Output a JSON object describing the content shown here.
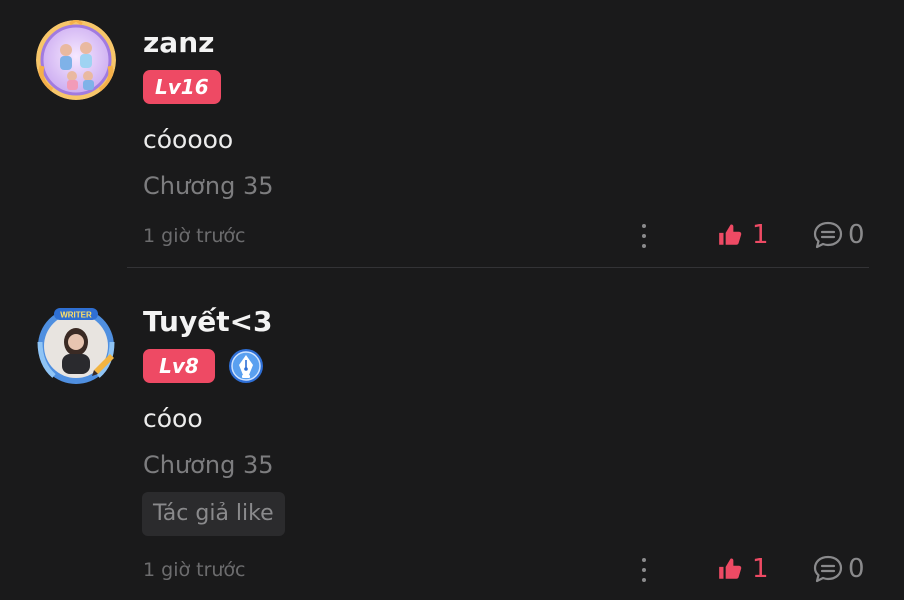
{
  "comments": [
    {
      "username": "zanz",
      "level": "Lv16",
      "content": "cóoooo",
      "chapter": "Chương 35",
      "timestamp": "1 giờ trước",
      "likes": "1",
      "replies": "0",
      "avatar_icon": "avatar-cartoon-frame",
      "author_liked": false
    },
    {
      "username": "Tuyết<3",
      "level": "Lv8",
      "writer_badge_icon": "pen-nib-icon",
      "avatar_frame_text": "WRITER",
      "content": "cóoo",
      "chapter": "Chương 35",
      "author_like_label": "Tác giả like",
      "timestamp": "1 giờ trước",
      "likes": "1",
      "replies": "0",
      "avatar_icon": "avatar-writer-frame",
      "author_liked": true
    }
  ],
  "colors": {
    "background": "#1a1a1b",
    "accent": "#ee4a64",
    "muted_text": "#7d7d7f",
    "writer_badge": "#3b82e6"
  }
}
